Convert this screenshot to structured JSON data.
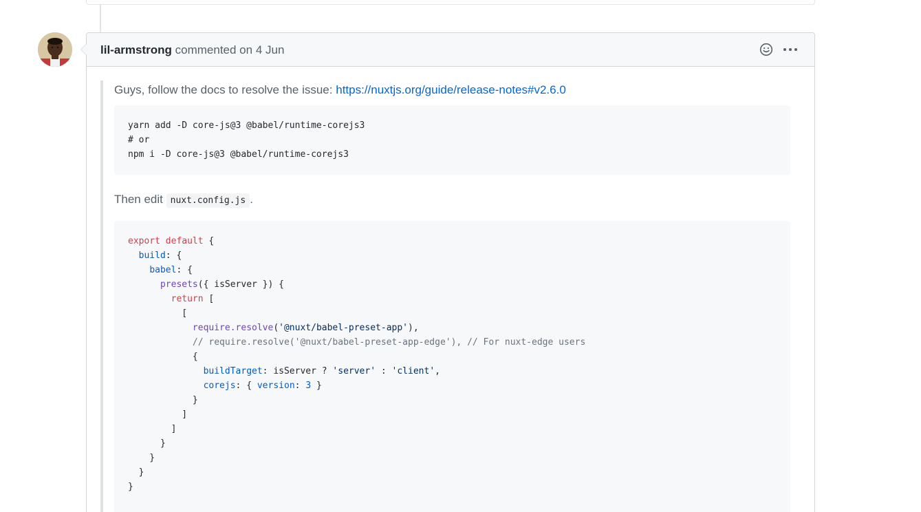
{
  "comment": {
    "author": "lil-armstrong",
    "action_text": "commented on 4 Jun",
    "body": {
      "intro_text": "Guys, follow the docs to resolve the issue:",
      "intro_link": "https://nuxtjs.org/guide/release-notes#v2.6.0",
      "install_code": [
        "yarn add -D core-js@3 @babel/runtime-corejs3",
        "# or",
        "npm i -D core-js@3 @babel/runtime-corejs3"
      ],
      "then_text": "Then edit",
      "config_file": "nuxt.config.js",
      "then_suffix": ".",
      "config_code": {
        "export": "export",
        "default": "default",
        "build": "build",
        "babel": "babel",
        "presets": "presets",
        "isServer_arg": "({ isServer }) {",
        "return": "return",
        "require_resolve": "require.resolve",
        "preset_app": "'@nuxt/babel-preset-app'",
        "edge_comment": "// require.resolve('@nuxt/babel-preset-app-edge'), // For nuxt-edge users",
        "buildTarget": "buildTarget",
        "buildTarget_expr": ": isServer ? ",
        "server_str": "'server'",
        "client_str": "'client'",
        "corejs": "corejs",
        "version": "version",
        "version_num": "3"
      }
    },
    "icons": {
      "reaction": "smiley-icon",
      "menu": "kebab-horizontal-icon"
    }
  },
  "colors": {
    "link": "#0366d6",
    "keyword": "#d73a49",
    "function": "#6f42c1",
    "property": "#005cc5",
    "string": "#032f62"
  }
}
